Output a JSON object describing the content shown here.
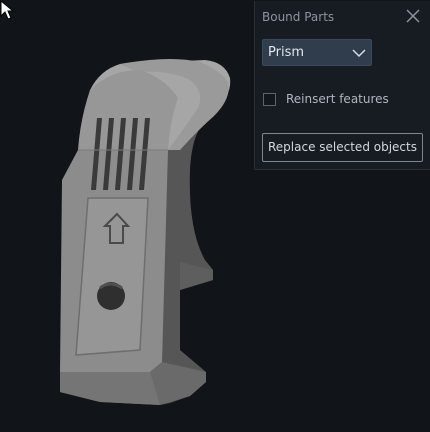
{
  "panel": {
    "title": "Bound Parts",
    "close_icon": "close-icon",
    "shape_dropdown": {
      "selected": "Prism",
      "icon": "chevron-down-icon"
    },
    "reinsert_features": {
      "label": "Reinsert features",
      "checked": false
    },
    "replace_button_label": "Replace selected objects"
  },
  "viewport": {
    "model": "3d-part-model",
    "cursor": "mouse-pointer-icon"
  },
  "colors": {
    "background": "#111418",
    "panel": "#171c22",
    "dropdown": "#2f3d4c",
    "model_front": "#8a8a8a",
    "model_top": "#a5a5a5"
  }
}
